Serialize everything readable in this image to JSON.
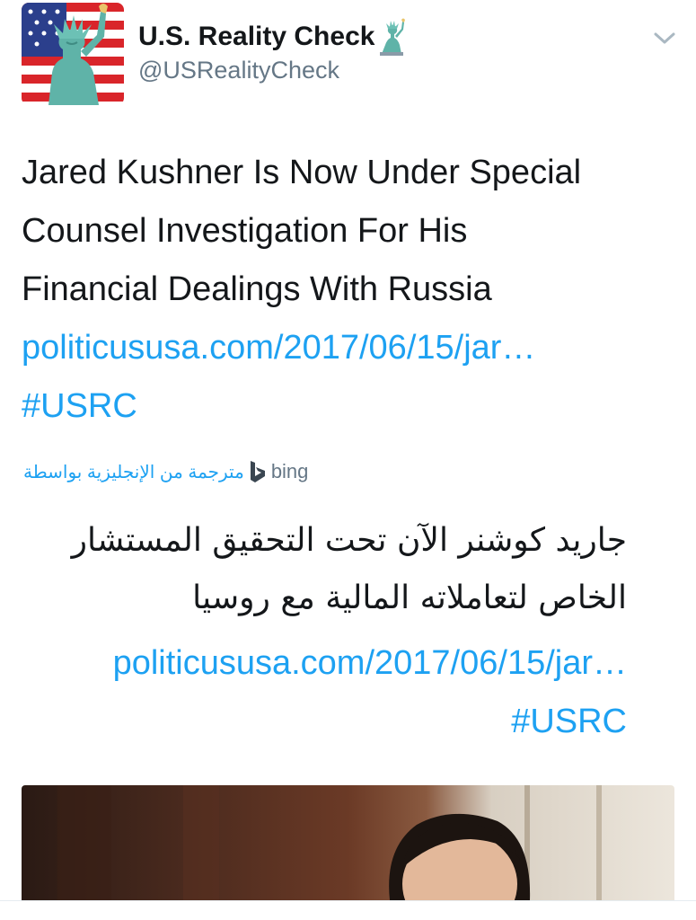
{
  "tweet": {
    "display_name": "U.S. Reality Check",
    "name_emoji": "statue-of-liberty",
    "handle": "@USRealityCheck",
    "text_lines": [
      "Jared Kushner Is Now Under Special",
      "Counsel Investigation For His",
      "Financial Dealings With Russia"
    ],
    "link": "politicususa.com/2017/06/15/jar…",
    "hashtag": "#USRC"
  },
  "translation": {
    "label": "مترجمة من الإنجليزية بواسطة",
    "provider": "bing",
    "text_lines": [
      "جاريد كوشنر الآن تحت التحقيق المستشار",
      "الخاص لتعاملاته المالية مع روسيا"
    ],
    "link": "politicususa.com/2017/06/15/jar…",
    "hashtag": "#USRC"
  },
  "icons": {
    "avatar": "statue-of-liberty-flag-avatar",
    "menu": "chevron-down-icon",
    "bing": "bing-logo-icon"
  },
  "colors": {
    "link": "#1da1f2",
    "secondary_text": "#657786",
    "primary_text": "#14171a"
  }
}
